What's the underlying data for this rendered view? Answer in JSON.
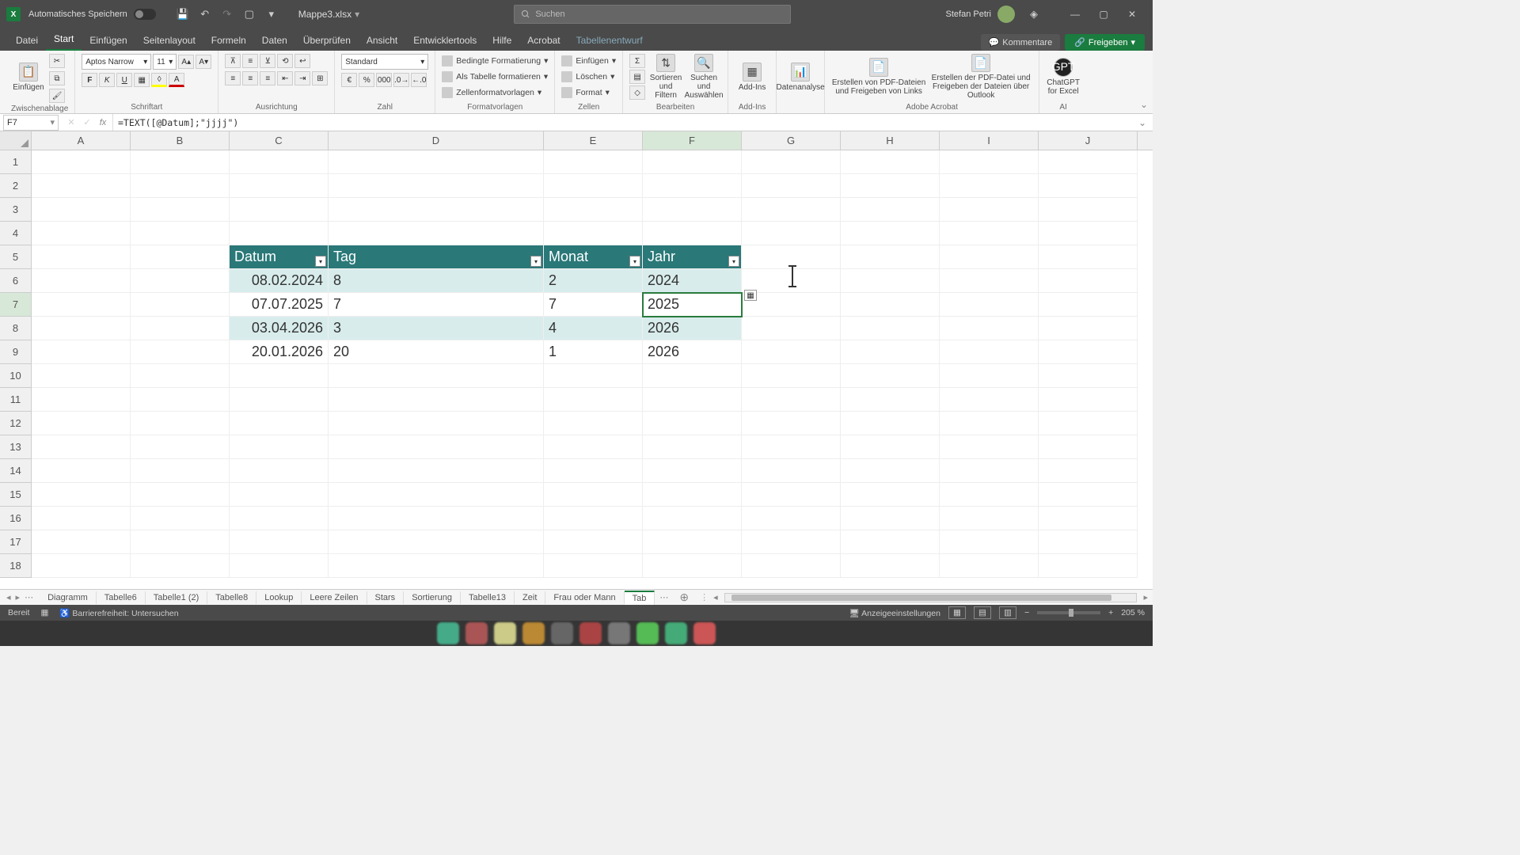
{
  "title": {
    "autosave": "Automatisches Speichern",
    "filename": "Mappe3.xlsx",
    "search_placeholder": "Suchen",
    "user": "Stefan Petri"
  },
  "ribbon_tabs": [
    "Datei",
    "Start",
    "Einfügen",
    "Seitenlayout",
    "Formeln",
    "Daten",
    "Überprüfen",
    "Ansicht",
    "Entwicklertools",
    "Hilfe",
    "Acrobat",
    "Tabellenentwurf"
  ],
  "ribbon_active": "Start",
  "ribbon_right": {
    "comments": "Kommentare",
    "share": "Freigeben"
  },
  "ribbon": {
    "clipboard": {
      "paste": "Einfügen",
      "label": "Zwischenablage"
    },
    "font": {
      "name": "Aptos Narrow",
      "size": "11",
      "label": "Schriftart"
    },
    "alignment": {
      "label": "Ausrichtung"
    },
    "number": {
      "format": "Standard",
      "label": "Zahl"
    },
    "styles": {
      "cond": "Bedingte Formatierung",
      "astable": "Als Tabelle formatieren",
      "cellstyles": "Zellenformatvorlagen",
      "label": "Formatvorlagen"
    },
    "cells": {
      "insert": "Einfügen",
      "delete": "Löschen",
      "format": "Format",
      "label": "Zellen"
    },
    "editing": {
      "sort": "Sortieren und Filtern",
      "find": "Suchen und Auswählen",
      "label": "Bearbeiten"
    },
    "addins": {
      "addins": "Add-Ins",
      "label": "Add-Ins"
    },
    "data": {
      "analysis": "Datenanalyse"
    },
    "acrobat": {
      "pdf1": "Erstellen von PDF-Dateien und Freigeben von Links",
      "pdf2": "Erstellen der PDF-Datei und Freigeben der Dateien über Outlook",
      "label": "Adobe Acrobat"
    },
    "ai": {
      "gpt": "ChatGPT for Excel",
      "label": "AI"
    }
  },
  "namebox": "F7",
  "formula": "=TEXT([@Datum];\"jjjj\")",
  "columns": [
    "A",
    "B",
    "C",
    "D",
    "E",
    "F",
    "G",
    "H",
    "I",
    "J"
  ],
  "rows": [
    "1",
    "2",
    "3",
    "4",
    "5",
    "6",
    "7",
    "8",
    "9",
    "10",
    "11",
    "12",
    "13",
    "14",
    "15",
    "16",
    "17",
    "18"
  ],
  "table": {
    "headers": {
      "datum": "Datum",
      "tag": "Tag",
      "monat": "Monat",
      "jahr": "Jahr"
    },
    "data": [
      {
        "datum": "08.02.2024",
        "tag": "8",
        "monat": "2",
        "jahr": "2024"
      },
      {
        "datum": "07.07.2025",
        "tag": "7",
        "monat": "7",
        "jahr": "2025"
      },
      {
        "datum": "03.04.2026",
        "tag": "3",
        "monat": "4",
        "jahr": "2026"
      },
      {
        "datum": "20.01.2026",
        "tag": "20",
        "monat": "1",
        "jahr": "2026"
      }
    ]
  },
  "sheet_tabs": [
    "Diagramm",
    "Tabelle6",
    "Tabelle1 (2)",
    "Tabelle8",
    "Lookup",
    "Leere Zeilen",
    "Stars",
    "Sortierung",
    "Tabelle13",
    "Zeit",
    "Frau oder Mann",
    "Tab"
  ],
  "sheet_active": "Tab",
  "status": {
    "ready": "Bereit",
    "access": "Barrierefreiheit: Untersuchen",
    "display": "Anzeigeeinstellungen",
    "zoom": "205 %"
  }
}
